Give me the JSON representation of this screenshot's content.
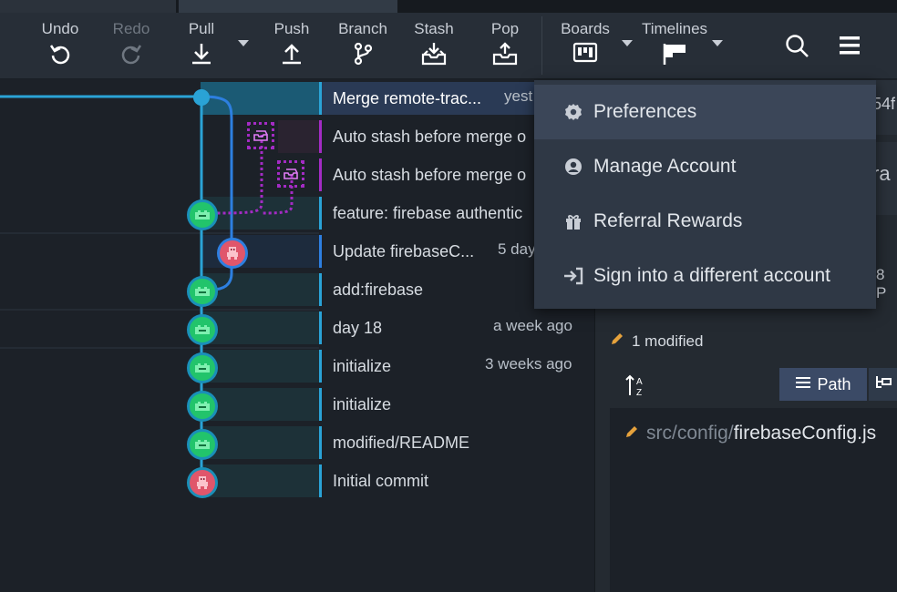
{
  "toolbar": {
    "undo": "Undo",
    "redo": "Redo",
    "pull": "Pull",
    "push": "Push",
    "branch": "Branch",
    "stash": "Stash",
    "pop": "Pop",
    "boards": "Boards",
    "timelines": "Timelines"
  },
  "commits": [
    {
      "message": "Merge remote-trac...",
      "time": "yest"
    },
    {
      "message": "Auto stash before merge o",
      "time": ""
    },
    {
      "message": "Auto stash before merge o",
      "time": ""
    },
    {
      "message": "feature: firebase authentic",
      "time": ""
    },
    {
      "message": "Update firebaseC...",
      "time": "5 day"
    },
    {
      "message": "add:firebase",
      "time": ""
    },
    {
      "message": "day 18",
      "time": "a week ago"
    },
    {
      "message": "initialize",
      "time": "3 weeks ago"
    },
    {
      "message": "initialize",
      "time": ""
    },
    {
      "message": "modified/README",
      "time": ""
    },
    {
      "message": "Initial commit",
      "time": ""
    }
  ],
  "menu": {
    "items": [
      {
        "label": "Preferences",
        "icon": "gear-icon"
      },
      {
        "label": "Manage Account",
        "icon": "account-icon"
      },
      {
        "label": "Referral Rewards",
        "icon": "gift-icon"
      },
      {
        "label": "Sign into a different account",
        "icon": "sign-in-icon"
      }
    ]
  },
  "right_panel": {
    "sha_fragment": "54f",
    "partial_text_1": "ra",
    "partial_text_2": "8 P",
    "modified_count": "1 modified",
    "view_path_label": "Path",
    "file_dir": "src/config/",
    "file_name": "firebaseConfig.js"
  },
  "colors": {
    "accent_blue": "#2aa3d6",
    "branch_blue": "#2d7fe0",
    "stash_magenta": "#a32bc4",
    "node_green": "#22c46b",
    "node_red": "#e0566b"
  }
}
